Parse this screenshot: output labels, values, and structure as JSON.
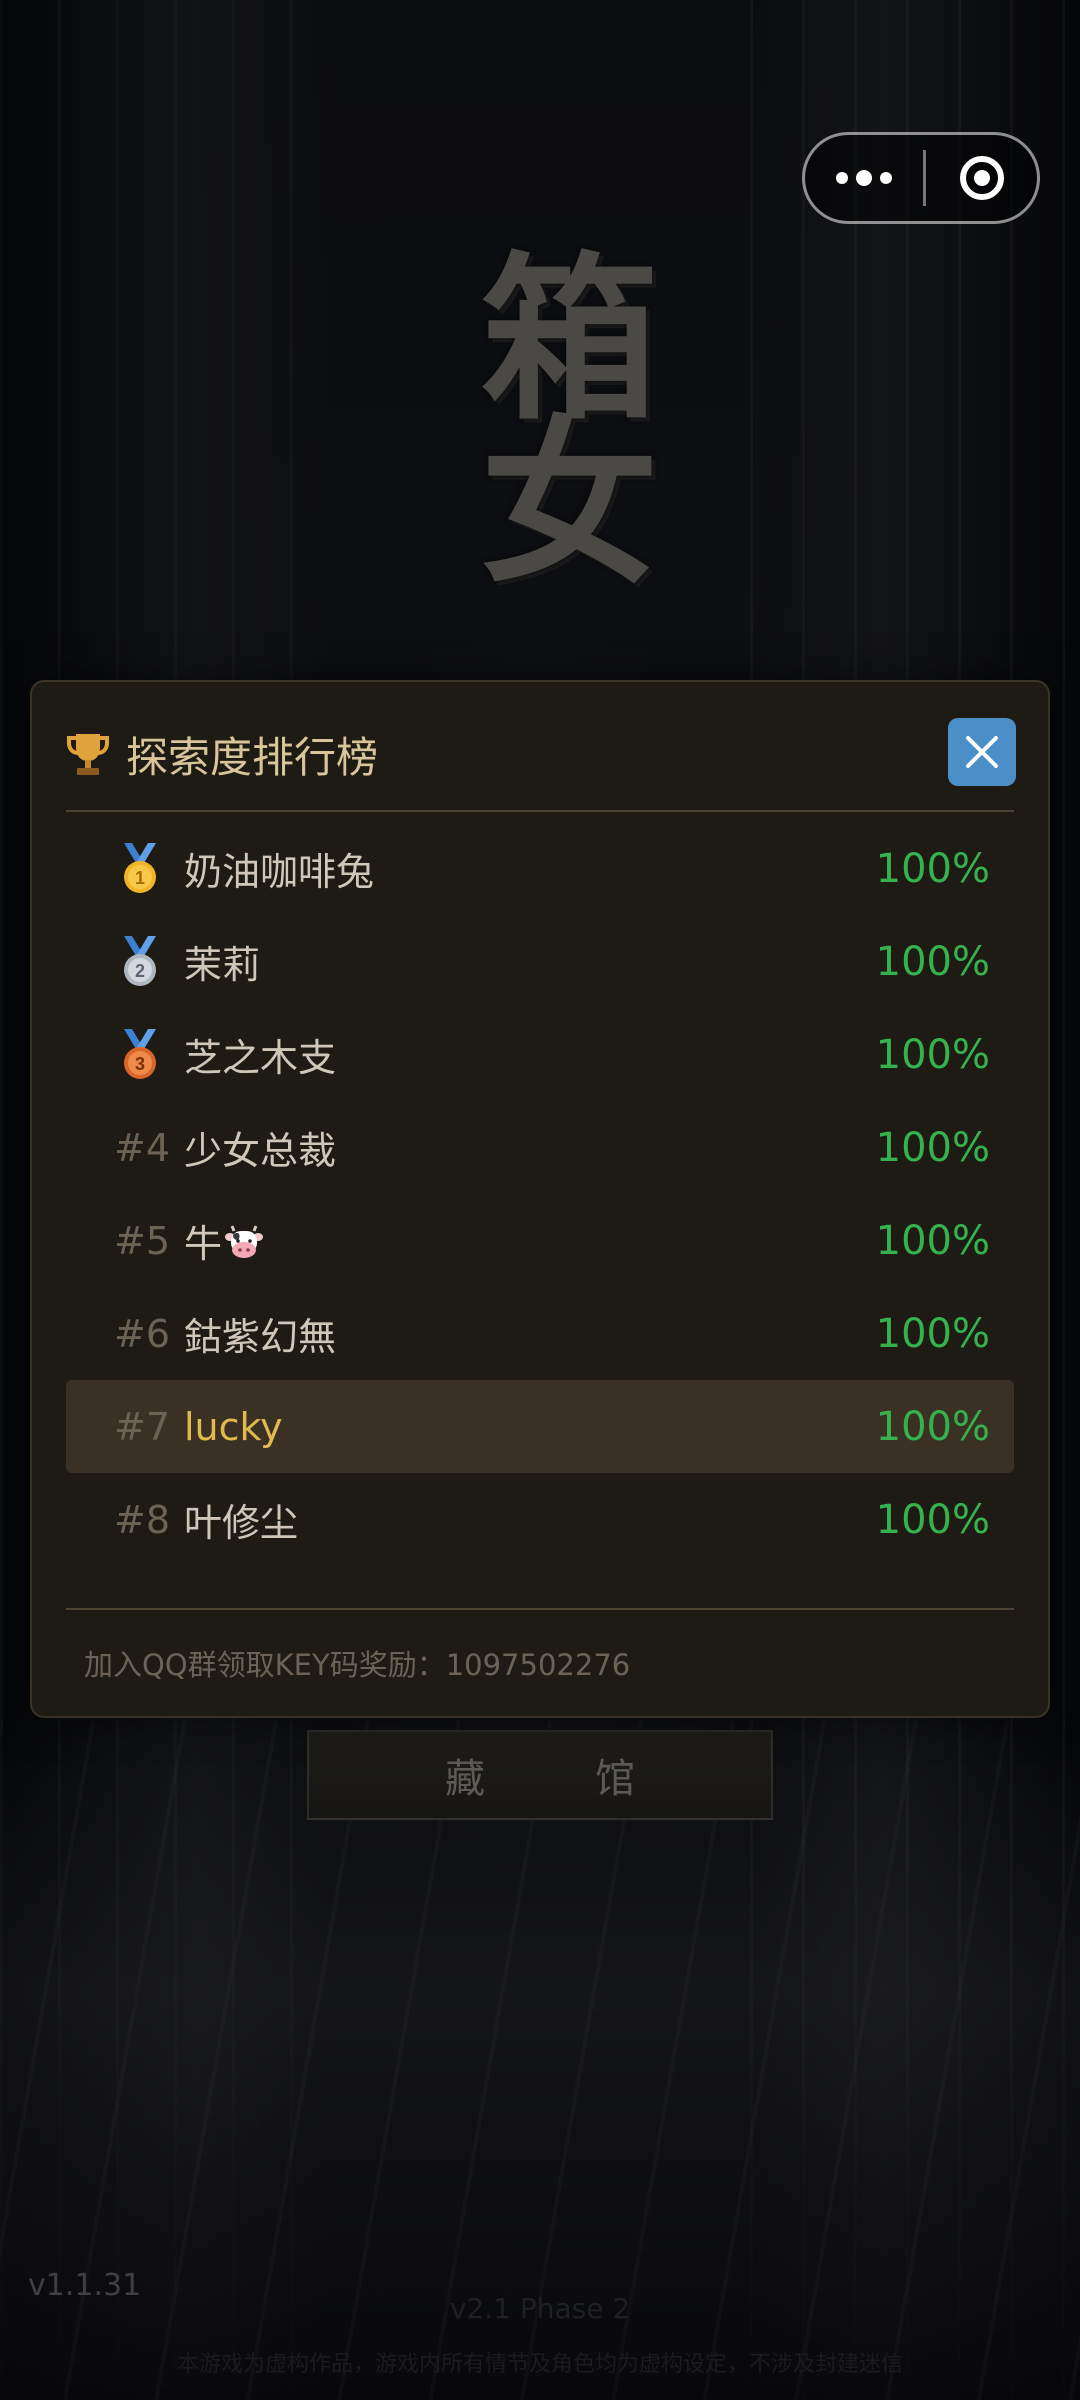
{
  "capsule": {
    "more_icon": "more-dots-icon",
    "close_icon": "target-close-icon"
  },
  "game": {
    "title": "箱女",
    "museum_button": "藏馆",
    "version": "v1.1.31",
    "phase": "v2.1    Phase 2",
    "footnote": "本游戏为虚构作品，游戏内所有情节及角色均为虚构设定，不涉及封建迷信"
  },
  "leaderboard": {
    "title": "探索度排行榜",
    "trophy_icon": "trophy-icon",
    "close_icon": "close-x-icon",
    "accent_close": "#4a8fc7",
    "score_color": "#35b24d",
    "highlight_color": "#e2b94d",
    "rows": [
      {
        "rank": "",
        "medal": "gold",
        "name": "奶油咖啡兔",
        "score": "100%"
      },
      {
        "rank": "",
        "medal": "silver",
        "name": "茉莉",
        "score": "100%"
      },
      {
        "rank": "",
        "medal": "bronze",
        "name": "芝之木支",
        "score": "100%"
      },
      {
        "rank": "#4",
        "medal": "",
        "name": "少女总裁",
        "score": "100%"
      },
      {
        "rank": "#5",
        "medal": "",
        "name": "牛",
        "score": "100%"
      },
      {
        "rank": "#6",
        "medal": "",
        "name": "鈷紫幻無",
        "score": "100%"
      },
      {
        "rank": "#7",
        "medal": "",
        "name": "lucky",
        "score": "100%"
      },
      {
        "rank": "#8",
        "medal": "",
        "name": "叶修尘",
        "score": "100%"
      }
    ],
    "footer": "加入QQ群领取KEY码奖励：1097502276"
  }
}
